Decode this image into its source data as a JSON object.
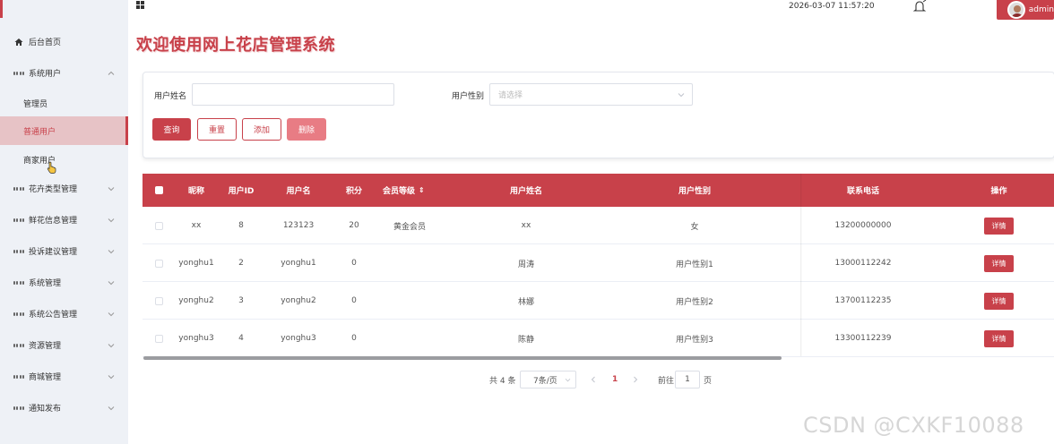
{
  "sidebar": {
    "items": [
      {
        "label": "后台首页"
      },
      {
        "label": "系统用户"
      },
      {
        "label": "管理员"
      },
      {
        "label": "普通用户"
      },
      {
        "label": "商家用户"
      },
      {
        "label": "花卉类型管理"
      },
      {
        "label": "鲜花信息管理"
      },
      {
        "label": "投诉建议管理"
      },
      {
        "label": "系统管理"
      },
      {
        "label": "系统公告管理"
      },
      {
        "label": "资源管理"
      },
      {
        "label": "商城管理"
      },
      {
        "label": "通知发布"
      }
    ]
  },
  "header": {
    "datetime": "2026-03-07 11:57:20",
    "username": "admin"
  },
  "page_title": "欢迎使用网上花店管理系统",
  "search": {
    "name_label": "用户姓名",
    "name_value": "",
    "gender_label": "用户性别",
    "gender_placeholder": "请选择",
    "btn_query": "查询",
    "btn_reset": "重置",
    "btn_add": "添加",
    "btn_delete": "删除"
  },
  "table": {
    "headers": [
      "昵称",
      "用户ID",
      "用户名",
      "积分",
      "会员等级",
      "用户姓名",
      "用户性别",
      "联系电话",
      "操作"
    ],
    "sort_icon": "⇕",
    "rows": [
      {
        "nickname": "xx",
        "id": "8",
        "username": "123123",
        "points": "20",
        "level": "黄金会员",
        "name": "xx",
        "gender": "女",
        "phone": "13200000000",
        "action": "详情"
      },
      {
        "nickname": "yonghu1",
        "id": "2",
        "username": "yonghu1",
        "points": "0",
        "level": "",
        "name": "周涛",
        "gender": "用户性别1",
        "phone": "13000112242",
        "action": "详情"
      },
      {
        "nickname": "yonghu2",
        "id": "3",
        "username": "yonghu2",
        "points": "0",
        "level": "",
        "name": "林娜",
        "gender": "用户性别2",
        "phone": "13700112235",
        "action": "详情"
      },
      {
        "nickname": "yonghu3",
        "id": "4",
        "username": "yonghu3",
        "points": "0",
        "level": "",
        "name": "陈静",
        "gender": "用户性别3",
        "phone": "13300112239",
        "action": "详情"
      }
    ]
  },
  "pagination": {
    "total": "共 4 条",
    "page_size": "7条/页",
    "current_page": "1",
    "goto_label": "前往",
    "goto_value": "1",
    "page_unit": "页"
  },
  "watermark": "CSDN @CXKF10088",
  "colors": {
    "accent": "#c8414a",
    "sidebar_bg": "#eef1f6",
    "active_bg": "#e7c3c6"
  }
}
